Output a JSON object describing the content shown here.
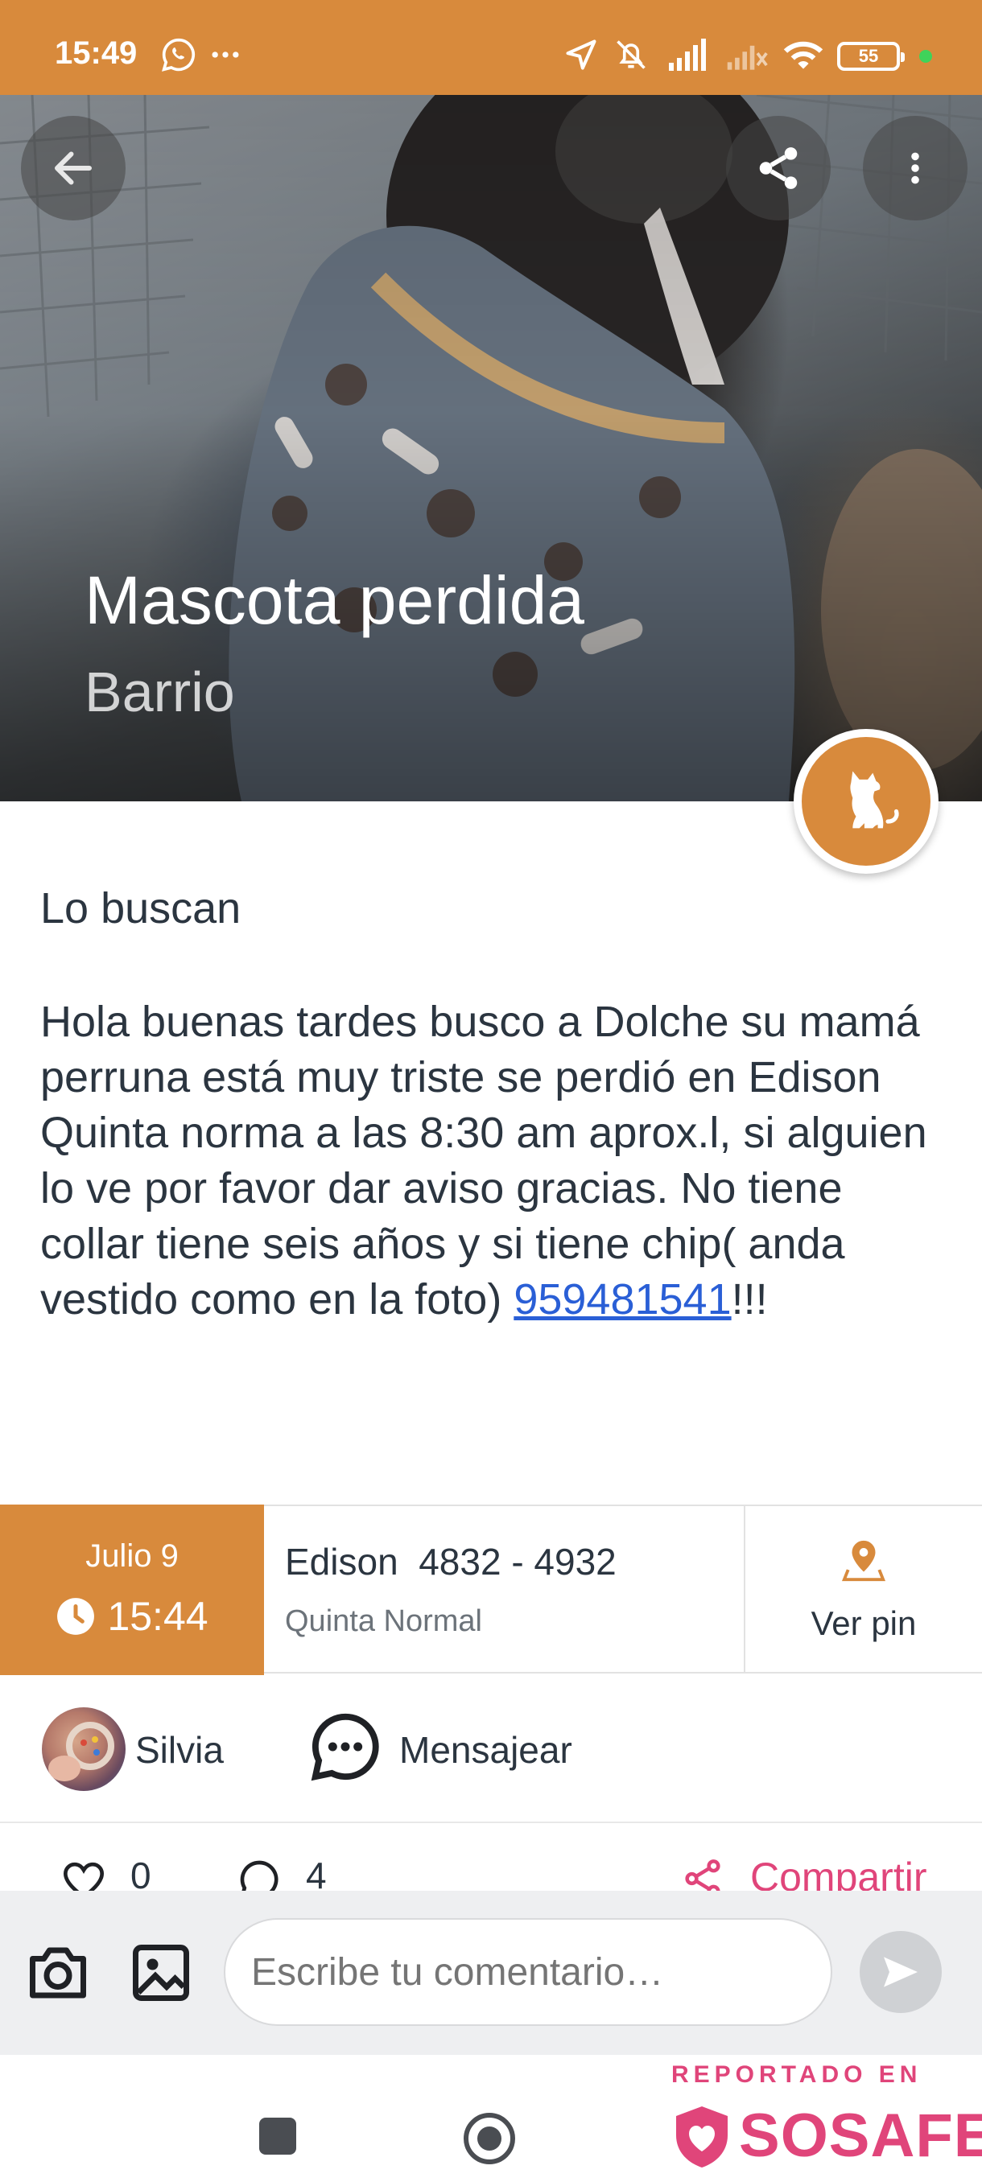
{
  "status_bar": {
    "time": "15:49",
    "battery": "55",
    "icons": [
      "whatsapp-icon",
      "more-notifications-icon",
      "location-icon",
      "mute-icon",
      "signal-icon",
      "signal-weak-icon",
      "wifi-icon",
      "battery-icon"
    ]
  },
  "hero": {
    "title": "Mascota perdida",
    "subtitle": "Barrio",
    "category_icon": "dog-icon"
  },
  "post": {
    "category": "Lo buscan",
    "description": "Hola buenas tardes busco a Dolche su mamá perruna está muy triste se perdió en Edison Quinta norma a las 8:30 am aprox.l, si alguien lo ve por favor dar aviso gracias. No tiene collar tiene seis años y si tiene chip( anda vestido como en la foto) ",
    "phone_link": "959481541",
    "description_end": "!!!"
  },
  "info": {
    "date": "Julio 9",
    "time": "15:44",
    "address": "Edison  4832 - 4932",
    "commune": "Quinta Normal",
    "pin_label": "Ver pin"
  },
  "author": {
    "name": "Silvia",
    "message_label": "Mensajear"
  },
  "actions": {
    "likes": "0",
    "comments": "4",
    "share_label": "Compartir"
  },
  "comment_bar": {
    "placeholder": "Escribe tu comentario…"
  },
  "watermark": {
    "top": "REPORTADO EN",
    "brand": "SOSAFE"
  },
  "colors": {
    "accent": "#d88a3c",
    "link": "#2a5fd6",
    "share": "#e0457a"
  }
}
